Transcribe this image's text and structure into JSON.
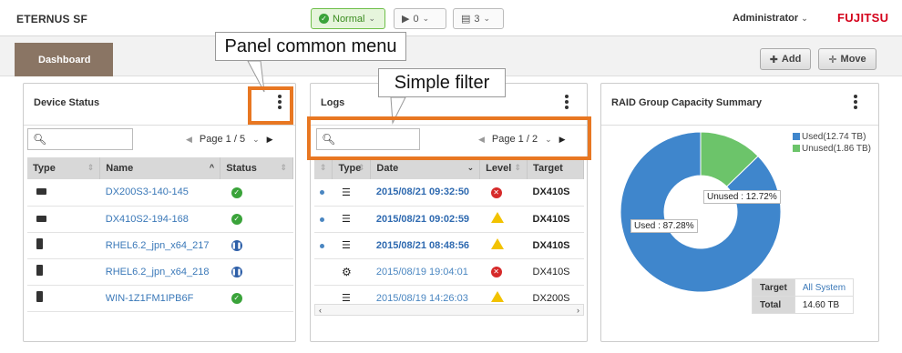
{
  "header": {
    "app_title": "ETERNUS SF",
    "status_normal": "Normal",
    "status_running": "0",
    "status_logs": "3",
    "user": "Administrator",
    "logo": "FUJITSU"
  },
  "toolbar": {
    "dashboard_tab": "Dashboard",
    "add_label": "Add",
    "move_label": "Move"
  },
  "callouts": {
    "panel_menu": "Panel common menu",
    "simple_filter": "Simple filter"
  },
  "device_status": {
    "title": "Device Status",
    "pager": "Page 1 / 5",
    "columns": [
      "Type",
      "Name",
      "Status"
    ],
    "rows": [
      {
        "type": "storage",
        "name": "DX200S3-140-145",
        "status": "ok"
      },
      {
        "type": "storage",
        "name": "DX410S2-194-168",
        "status": "ok"
      },
      {
        "type": "server",
        "name": "RHEL6.2_jpn_x64_217",
        "status": "paused"
      },
      {
        "type": "server",
        "name": "RHEL6.2_jpn_x64_218",
        "status": "paused"
      },
      {
        "type": "server",
        "name": "WIN-1Z1FM1IPB6F",
        "status": "ok"
      }
    ]
  },
  "logs": {
    "title": "Logs",
    "pager": "Page 1 / 2",
    "columns": [
      "Type",
      "Date",
      "Level",
      "Target"
    ],
    "rows": [
      {
        "unread": true,
        "type": "list",
        "date": "2015/08/21 09:32:50",
        "level": "error",
        "target": "DX410S"
      },
      {
        "unread": true,
        "type": "list",
        "date": "2015/08/21 09:02:59",
        "level": "warning",
        "target": "DX410S"
      },
      {
        "unread": true,
        "type": "list",
        "date": "2015/08/21 08:48:56",
        "level": "warning",
        "target": "DX410S"
      },
      {
        "unread": false,
        "type": "gear",
        "date": "2015/08/19 19:04:01",
        "level": "error",
        "target": "DX410S"
      },
      {
        "unread": false,
        "type": "list",
        "date": "2015/08/19 14:26:03",
        "level": "warning",
        "target": "DX200S"
      }
    ]
  },
  "raid": {
    "title": "RAID Group Capacity Summary",
    "legend_used": "Used(12.74 TB)",
    "legend_unused": "Unused(1.86 TB)",
    "label_used": "Used : 87.28%",
    "label_unused": "Unused : 12.72%",
    "target_key": "Target",
    "target_value": "All System",
    "total_key": "Total",
    "total_value": "14.60 TB",
    "used_color": "#3f86cc",
    "unused_color": "#6cc46a"
  },
  "chart_data": {
    "type": "pie",
    "categories": [
      "Used",
      "Unused"
    ],
    "values": [
      87.28,
      12.72
    ],
    "title": "RAID Group Capacity Summary"
  }
}
